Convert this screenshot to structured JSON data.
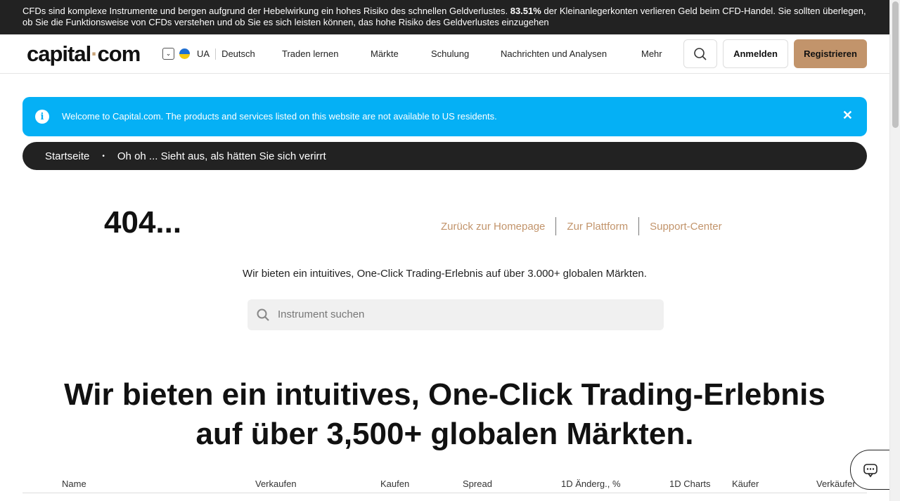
{
  "risk_warning": {
    "text_before": "CFDs sind komplexe Instrumente und bergen aufgrund der Hebelwirkung ein hohes Risiko des schnellen Geldverlustes. ",
    "percent": "83.51%",
    "text_after": " der Kleinanlegerkonten verlieren Geld beim CFD-Handel. Sie sollten überlegen, ob Sie die Funktionsweise von CFDs verstehen und ob Sie es sich leisten können, das hohe Risiko des Geldverlustes einzugehen"
  },
  "header": {
    "logo_left": "capital",
    "logo_dot": "·",
    "logo_right": "com",
    "country_code": "UA",
    "language": "Deutsch",
    "nav_items": [
      "Traden lernen",
      "Märkte",
      "Schulung",
      "Nachrichten und Analysen",
      "Mehr"
    ],
    "login_label": "Anmelden",
    "register_label": "Registrieren"
  },
  "info_banner": {
    "icon": "info-icon",
    "text": "Welcome to Capital.com. The products and services listed on this website are not available to US residents.",
    "close": "✕"
  },
  "breadcrumb": {
    "home": "Startseite",
    "separator": "•",
    "current": "Oh oh ... Sieht aus, als hätten Sie sich verirrt"
  },
  "error": {
    "title": "404...",
    "links": [
      "Zurück zur Homepage",
      "Zur Plattform",
      "Support-Center"
    ]
  },
  "tagline": "Wir bieten ein intuitives, One-Click Trading-Erlebnis auf über 3.000+ globalen Märkten.",
  "search": {
    "placeholder": "Instrument suchen"
  },
  "headline": {
    "line1": "Wir bieten ein intuitives, One-Click Trading-Erlebnis",
    "line2": "auf über 3,500+ globalen Märkten."
  },
  "market_table": {
    "columns": [
      "Name",
      "Verkaufen",
      "Kaufen",
      "Spread",
      "1D Änderg., %",
      "1D Charts",
      "Käufer",
      "Verkäufer"
    ]
  },
  "colors": {
    "accent": "#c2946b",
    "info": "#05b0f5",
    "dark": "#222222"
  }
}
